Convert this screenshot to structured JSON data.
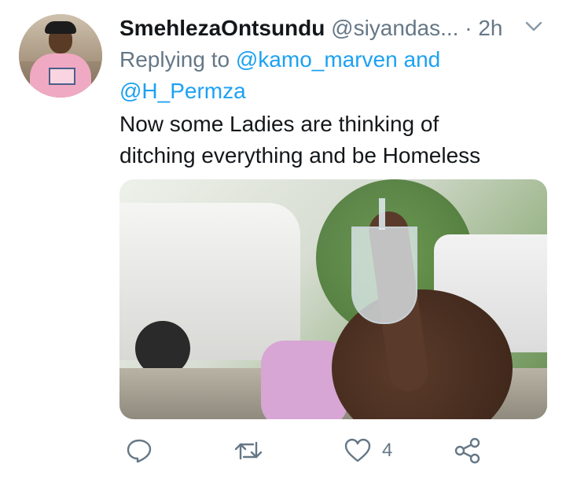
{
  "tweet": {
    "display_name": "SmehlezaOntsundu",
    "handle": "@siyandas...",
    "separator": "·",
    "time": "2h",
    "replying_prefix": "Replying to",
    "replying_mention_1": "@kamo_marven",
    "replying_joiner": "and",
    "replying_mention_2": "@H_Permza",
    "text_line_1": "Now some Ladies are thinking of",
    "text_line_2": "ditching everything and be Homeless",
    "like_count": "4"
  },
  "colors": {
    "text": "#14171a",
    "secondary": "#657786",
    "accent": "#1da1f2"
  },
  "icons": {
    "more": "chevron-down-icon",
    "reply": "reply-icon",
    "retweet": "retweet-icon",
    "like": "heart-icon",
    "share": "share-icon"
  }
}
